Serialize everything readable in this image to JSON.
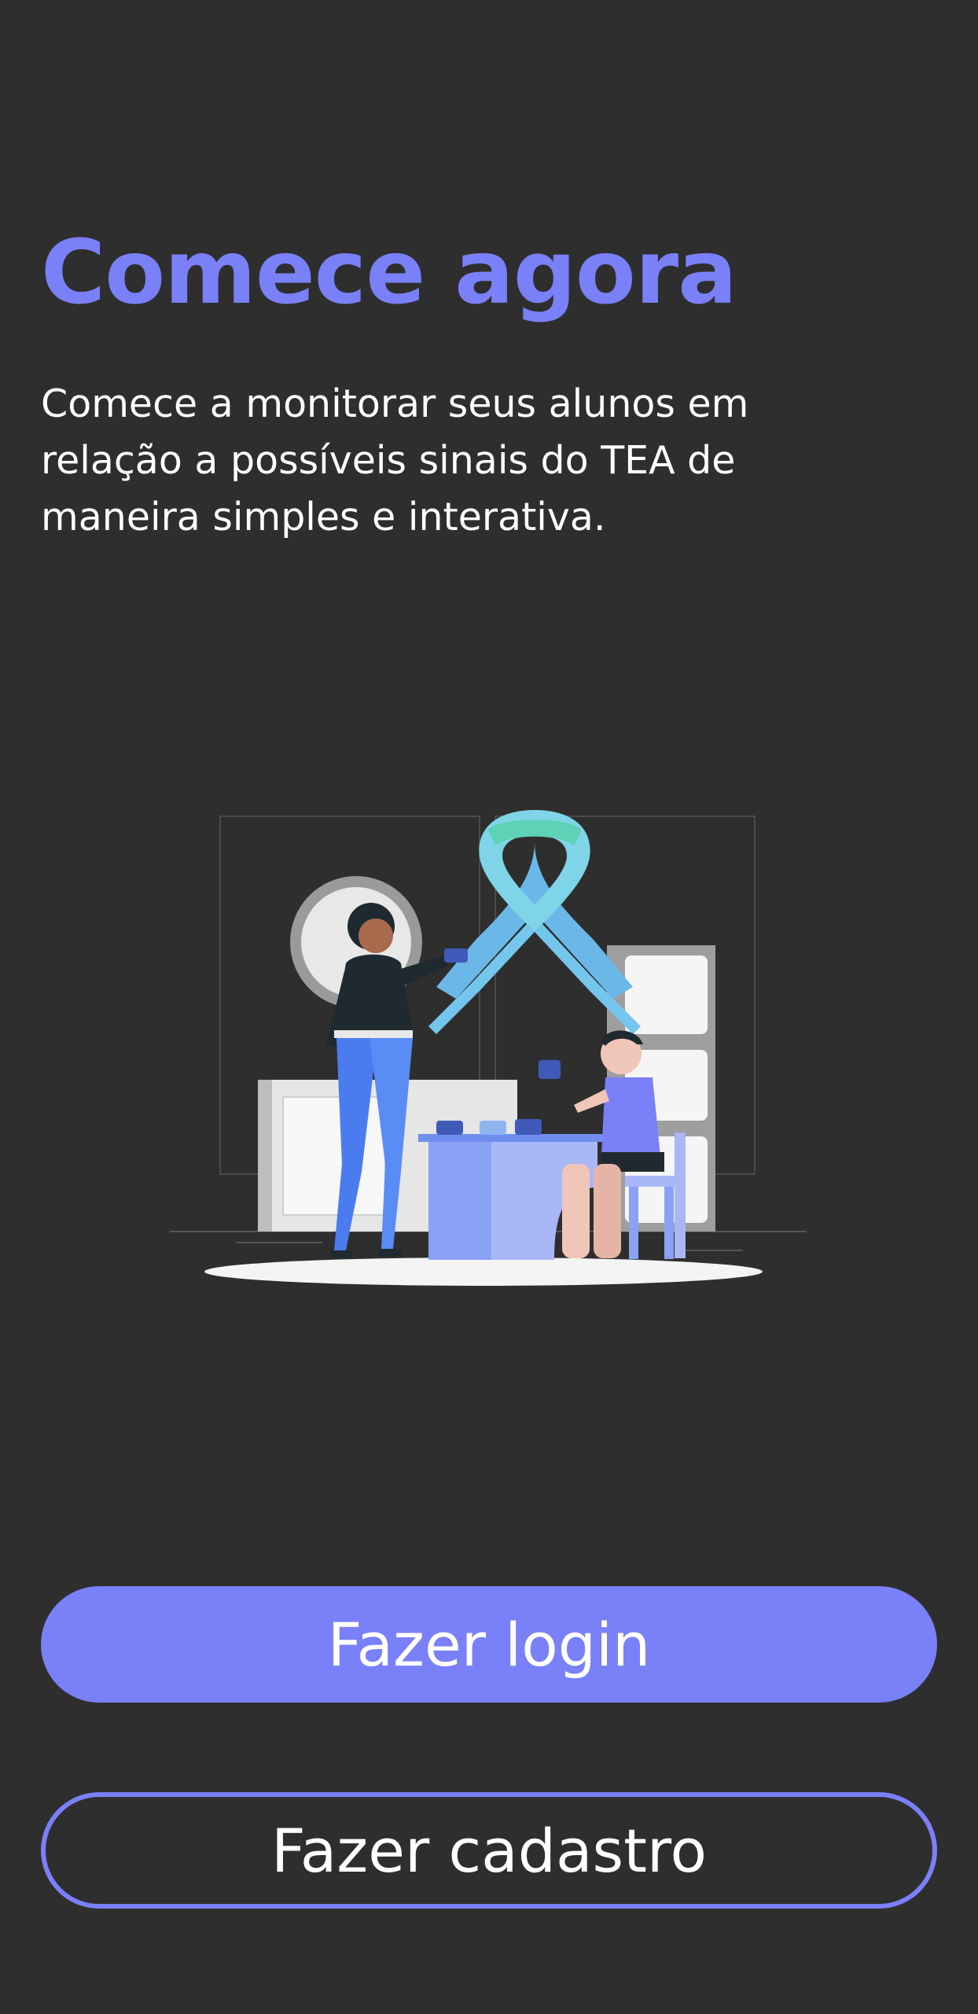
{
  "header": {
    "title": "Comece agora",
    "subtitle": "Comece a monitorar seus alunos em relação a possíveis sinais do TEA de maneira simples e interativa."
  },
  "illustration": {
    "icon": "autism-awareness-ribbon-illustration"
  },
  "actions": {
    "login_label": "Fazer login",
    "signup_label": "Fazer cadastro"
  },
  "colors": {
    "background": "#2e2e2e",
    "accent": "#7a80f7",
    "text": "#ffffff"
  }
}
